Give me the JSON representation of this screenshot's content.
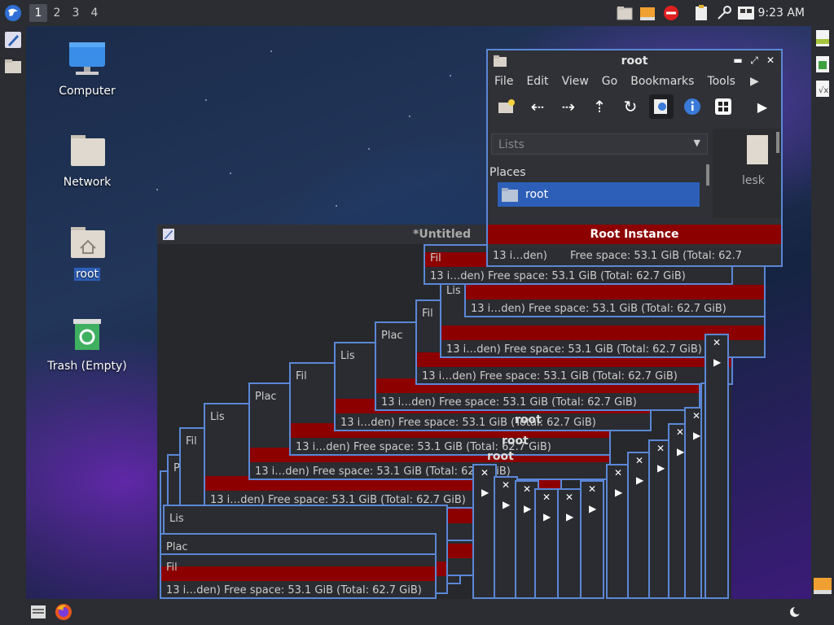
{
  "top_panel": {
    "workspaces": [
      "1",
      "2",
      "3",
      "4"
    ],
    "active_workspace": "1",
    "clock": "9:23 AM"
  },
  "desktop": {
    "icons": [
      {
        "label": "Computer",
        "icon": "computer-icon"
      },
      {
        "label": "Network",
        "icon": "folder-icon"
      },
      {
        "label": "root",
        "icon": "home-folder-icon"
      },
      {
        "label": "Trash (Empty)",
        "icon": "trash-icon"
      }
    ]
  },
  "file_manager": {
    "title": "root",
    "menu": [
      "File",
      "Edit",
      "View",
      "Go",
      "Bookmarks",
      "Tools"
    ],
    "side_pane_mode": "Lists",
    "places_heading": "Places",
    "places_selected": "root",
    "right_item_label": "lesk",
    "root_banner": "Root Instance",
    "status_left": "13 i…den)",
    "status_right": "Free space: 53.1 GiB (Total: 62.7"
  },
  "editor_window": {
    "title": "*Untitled"
  },
  "ghost_status": "13 i…den)   Free space: 53.1 GiB (Total: 62.7 GiB)",
  "ghost_fragments": {
    "file": "Fil",
    "list": "Lis",
    "place": "Plac",
    "root": "root"
  },
  "colors": {
    "accent_border": "#5b87d6",
    "selection": "#2d5fb8",
    "root_banner": "#8c0000",
    "panel_bg": "#2b2d33"
  }
}
